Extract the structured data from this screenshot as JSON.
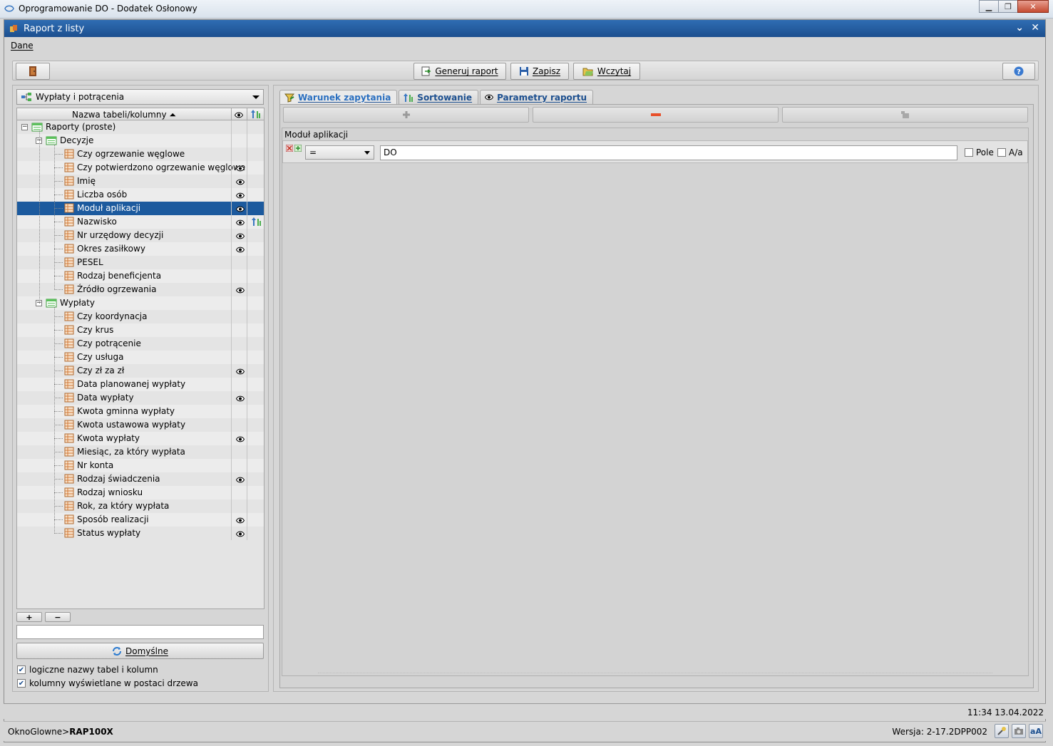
{
  "os_window": {
    "title": "Oprogramowanie DO - Dodatek Osłonowy"
  },
  "window": {
    "title": "Raport z listy"
  },
  "menu": {
    "dane": "Dane"
  },
  "toolbar": {
    "generate": "Generuj raport",
    "save": "Zapisz",
    "load": "Wczytaj"
  },
  "left": {
    "combo": "Wypłaty i potrącenia",
    "column_header": "Nazwa tabeli/kolumny",
    "tree": [
      {
        "label": "Raporty (proste)",
        "level": 0,
        "type": "root",
        "eye": false,
        "sort": false
      },
      {
        "label": "Decyzje",
        "level": 1,
        "type": "folder",
        "eye": false,
        "sort": false
      },
      {
        "label": "Czy ogrzewanie węglowe",
        "level": 2,
        "type": "field",
        "eye": false,
        "sort": false
      },
      {
        "label": "Czy potwierdzono ogrzewanie węglowe",
        "level": 2,
        "type": "field",
        "eye": true,
        "sort": false
      },
      {
        "label": "Imię",
        "level": 2,
        "type": "field",
        "eye": true,
        "sort": false
      },
      {
        "label": "Liczba osób",
        "level": 2,
        "type": "field",
        "eye": true,
        "sort": false
      },
      {
        "label": "Moduł aplikacji",
        "level": 2,
        "type": "field",
        "eye": true,
        "sort": false,
        "selected": true
      },
      {
        "label": "Nazwisko",
        "level": 2,
        "type": "field",
        "eye": true,
        "sort": true
      },
      {
        "label": "Nr urzędowy decyzji",
        "level": 2,
        "type": "field",
        "eye": true,
        "sort": false
      },
      {
        "label": "Okres zasiłkowy",
        "level": 2,
        "type": "field",
        "eye": true,
        "sort": false
      },
      {
        "label": "PESEL",
        "level": 2,
        "type": "field",
        "eye": false,
        "sort": false
      },
      {
        "label": "Rodzaj beneficjenta",
        "level": 2,
        "type": "field",
        "eye": false,
        "sort": false
      },
      {
        "label": "Źródło ogrzewania",
        "level": 2,
        "type": "field",
        "eye": true,
        "sort": false
      },
      {
        "label": "Wypłaty",
        "level": 1,
        "type": "folder",
        "eye": false,
        "sort": false
      },
      {
        "label": "Czy koordynacja",
        "level": 2,
        "type": "field",
        "eye": false,
        "sort": false
      },
      {
        "label": "Czy krus",
        "level": 2,
        "type": "field",
        "eye": false,
        "sort": false
      },
      {
        "label": "Czy potrącenie",
        "level": 2,
        "type": "field",
        "eye": false,
        "sort": false
      },
      {
        "label": "Czy usługa",
        "level": 2,
        "type": "field",
        "eye": false,
        "sort": false
      },
      {
        "label": "Czy zł za zł",
        "level": 2,
        "type": "field",
        "eye": true,
        "sort": false
      },
      {
        "label": "Data planowanej wypłaty",
        "level": 2,
        "type": "field",
        "eye": false,
        "sort": false
      },
      {
        "label": "Data wypłaty",
        "level": 2,
        "type": "field",
        "eye": true,
        "sort": false
      },
      {
        "label": "Kwota gminna wypłaty",
        "level": 2,
        "type": "field",
        "eye": false,
        "sort": false
      },
      {
        "label": "Kwota ustawowa wypłaty",
        "level": 2,
        "type": "field",
        "eye": false,
        "sort": false
      },
      {
        "label": "Kwota wypłaty",
        "level": 2,
        "type": "field",
        "eye": true,
        "sort": false
      },
      {
        "label": "Miesiąc, za który wypłata",
        "level": 2,
        "type": "field",
        "eye": false,
        "sort": false
      },
      {
        "label": "Nr konta",
        "level": 2,
        "type": "field",
        "eye": false,
        "sort": false
      },
      {
        "label": "Rodzaj świadczenia",
        "level": 2,
        "type": "field",
        "eye": true,
        "sort": false
      },
      {
        "label": "Rodzaj wniosku",
        "level": 2,
        "type": "field",
        "eye": false,
        "sort": false
      },
      {
        "label": "Rok, za który wypłata",
        "level": 2,
        "type": "field",
        "eye": false,
        "sort": false
      },
      {
        "label": "Sposób realizacji",
        "level": 2,
        "type": "field",
        "eye": true,
        "sort": false
      },
      {
        "label": "Status wypłaty",
        "level": 2,
        "type": "field",
        "eye": true,
        "sort": false
      }
    ],
    "add_label": "+",
    "remove_label": "−",
    "filter_value": "",
    "default_button": "Domyślne",
    "check_logical": "logiczne nazwy tabel i kolumn",
    "check_tree": "kolumny wyświetlane w postaci drzewa"
  },
  "tabs": {
    "condition": "Warunek zapytania",
    "sorting": "Sortowanie",
    "params": "Parametry raportu"
  },
  "condition": {
    "field_label": "Moduł aplikacji",
    "operator": "=",
    "value": "DO",
    "opt_pole": "Pole",
    "opt_aa": "A/a"
  },
  "status": {
    "datetime": "11:34 13.04.2022",
    "path_prefix": "OknoGlowne>",
    "path_current": "RAP100X",
    "version": "Wersja: 2-17.2DPP002"
  },
  "colors": {
    "title_bar": "#1c4f8f",
    "selection": "#1c5a9e",
    "tab_text": "#2a6fc0"
  }
}
